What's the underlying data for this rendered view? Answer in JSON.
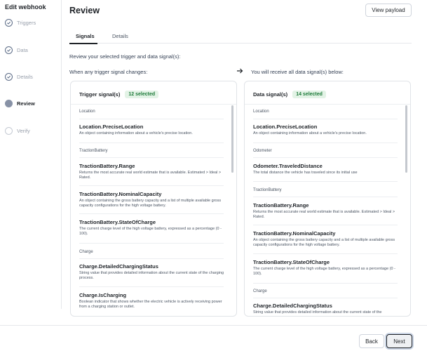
{
  "sidebar": {
    "title": "Edit webhook",
    "steps": [
      {
        "label": "Triggers",
        "state": "done",
        "icon": "check-icon"
      },
      {
        "label": "Data",
        "state": "done",
        "icon": "check-icon"
      },
      {
        "label": "Details",
        "state": "done",
        "icon": "check-icon"
      },
      {
        "label": "Review",
        "state": "current"
      },
      {
        "label": "Verify",
        "state": "todo"
      }
    ]
  },
  "header": {
    "title": "Review",
    "view_payload_label": "View payload"
  },
  "tabs": [
    {
      "label": "Signals",
      "active": true
    },
    {
      "label": "Details",
      "active": false
    }
  ],
  "intro": "Review your selected trigger and data signal(s):",
  "left_label": "When any trigger signal changes:",
  "right_label": "You will receive all data signal(s) below:",
  "trigger_panel": {
    "title": "Trigger signal(s)",
    "badge": "12 selected",
    "cat_location": "Location",
    "loc_name": "Location.PreciseLocation",
    "loc_desc": "An object containing information about a vehicle's precise location.",
    "cat_traction": "TractionBattery",
    "range_name": "TractionBattery.Range",
    "range_desc": "Returns the most accurate real world estimate that is available. Estimated > Ideal > Rated.",
    "cap_name": "TractionBattery.NominalCapacity",
    "cap_desc": "An object containing the gross battery capacity and a list of multiple available gross capacity configurations for the high voltage battery.",
    "soc_name": "TractionBattery.StateOfCharge",
    "soc_desc": "The current charge level of the high voltage battery, expressed as a percentage (0 - 100).",
    "cat_charge": "Charge",
    "dcs_name": "Charge.DetailedChargingStatus",
    "dcs_desc": "String value that provides detailed information about the current state of the charging process.",
    "isch_name": "Charge.IsCharging",
    "isch_desc": "Boolean indicator that shows whether the electric vehicle is actively receiving power from a charging station or outlet."
  },
  "data_panel": {
    "title": "Data signal(s)",
    "badge": "14 selected",
    "cat_location": "Location",
    "loc_name": "Location.PreciseLocation",
    "loc_desc": "An object containing information about a vehicle's precise location.",
    "cat_odometer": "Odometer",
    "odo_name": "Odometer.TraveledDistance",
    "odo_desc": "The total distance the vehicle has traveled since its initial use",
    "cat_traction": "TractionBattery",
    "range_name": "TractionBattery.Range",
    "range_desc": "Returns the most accurate real world estimate that is available. Estimated > Ideal > Rated.",
    "cap_name": "TractionBattery.NominalCapacity",
    "cap_desc": "An object containing the gross battery capacity and a list of multiple available gross capacity configurations for the high voltage battery.",
    "soc_name": "TractionBattery.StateOfCharge",
    "soc_desc": "The current charge level of the high voltage battery, expressed as a percentage (0 - 100).",
    "cat_charge": "Charge",
    "dcs_name": "Charge.DetailedChargingStatus",
    "dcs_desc": "String value that provides detailed information about the current state of the"
  },
  "footer": {
    "back_label": "Back",
    "next_label": "Next"
  },
  "colors": {
    "badge_bg": "#e3f3e6",
    "badge_text": "#1e7b3a",
    "step_done": "#5b6b86"
  }
}
